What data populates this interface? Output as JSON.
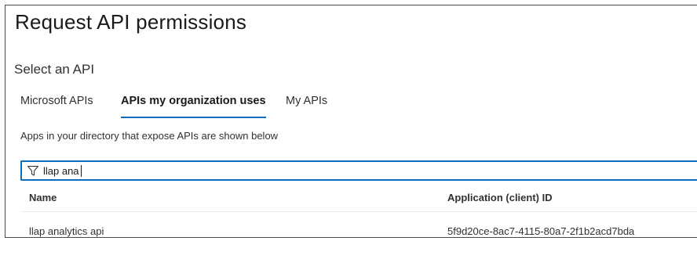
{
  "page_title": "Request API permissions",
  "section_title": "Select an API",
  "tabs": [
    {
      "label": "Microsoft APIs",
      "active": false
    },
    {
      "label": "APIs my organization uses",
      "active": true
    },
    {
      "label": "My APIs",
      "active": false
    }
  ],
  "description": "Apps in your directory that expose APIs are shown below",
  "filter": {
    "value": "llap ana",
    "icon": "filter-icon"
  },
  "table": {
    "columns": [
      "Name",
      "Application (client) ID"
    ],
    "rows": [
      [
        "llap analytics api",
        "5f9d20ce-8ac7-4115-80a7-2f1b2acd7bda"
      ]
    ]
  },
  "colors": {
    "accent": "#0f6cbd"
  }
}
